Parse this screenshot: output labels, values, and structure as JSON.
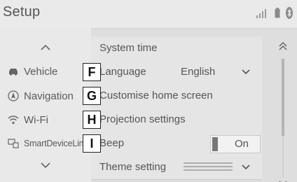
{
  "header": {
    "title": "Setup",
    "status_icons": [
      "signal-icon",
      "battery-icon",
      "bluetooth-icon"
    ]
  },
  "sidebar": {
    "scroll_up_icon": "chevron-up-icon",
    "scroll_down_icon": "chevron-down-icon",
    "items": [
      {
        "label": "Vehicle",
        "icon": "car-icon"
      },
      {
        "label": "Navigation",
        "icon": "navigation-icon"
      },
      {
        "label": "Wi-Fi",
        "icon": "wifi-icon"
      },
      {
        "label": "SmartDeviceLink™",
        "icon": "smartdevicelink-icon"
      }
    ]
  },
  "settings": {
    "rows": [
      {
        "label": "System time"
      },
      {
        "label": "Language",
        "value": "English",
        "marker": "F"
      },
      {
        "label": "Customise home screen",
        "marker": "G"
      },
      {
        "label": "Projection settings",
        "marker": "H"
      },
      {
        "label": "Beep",
        "toggle": "On",
        "marker": "I"
      },
      {
        "label": "Theme setting"
      }
    ]
  },
  "colors": {
    "background": "#dedede",
    "sidebar": "#e9e9e9",
    "row": "#e5e5e5",
    "text": "#555555"
  }
}
